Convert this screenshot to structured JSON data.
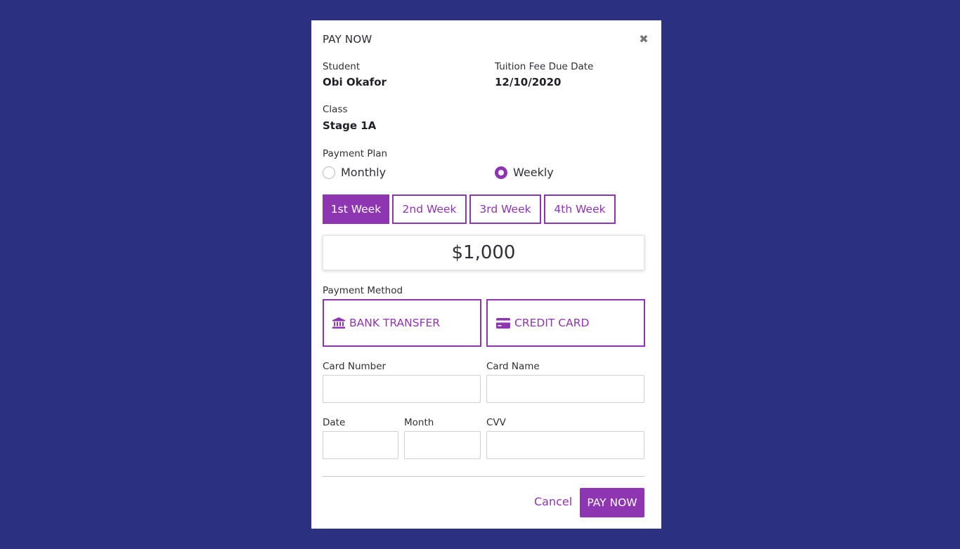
{
  "modal": {
    "title": "PAY NOW",
    "close_icon": "close-icon"
  },
  "student": {
    "label": "Student",
    "value": "Obi Okafor"
  },
  "due_date": {
    "label": "Tuition Fee Due Date",
    "value": "12/10/2020"
  },
  "class_info": {
    "label": "Class",
    "value": "Stage 1A"
  },
  "payment_plan": {
    "label": "Payment Plan",
    "options": [
      {
        "label": "Monthly",
        "selected": false
      },
      {
        "label": "Weekly",
        "selected": true
      }
    ]
  },
  "weeks": [
    {
      "label": "1st Week",
      "active": true
    },
    {
      "label": "2nd Week",
      "active": false
    },
    {
      "label": "3rd Week",
      "active": false
    },
    {
      "label": "4th Week",
      "active": false
    }
  ],
  "amount": "$1,000",
  "payment_method": {
    "label": "Payment Method",
    "options": [
      {
        "label": "BANK TRANSFER",
        "icon": "bank-icon"
      },
      {
        "label": "CREDIT CARD",
        "icon": "credit-card-icon"
      }
    ]
  },
  "card_form": {
    "card_number_label": "Card Number",
    "card_name_label": "Card Name",
    "date_label": "Date",
    "month_label": "Month",
    "cvv_label": "CVV",
    "card_number_value": "",
    "card_name_value": "",
    "date_value": "",
    "month_value": "",
    "cvv_value": ""
  },
  "footer": {
    "cancel_label": "Cancel",
    "pay_label": "PAY NOW"
  },
  "colors": {
    "background": "#2b3180",
    "accent": "#8e35b2",
    "modal": "#ffffff"
  }
}
